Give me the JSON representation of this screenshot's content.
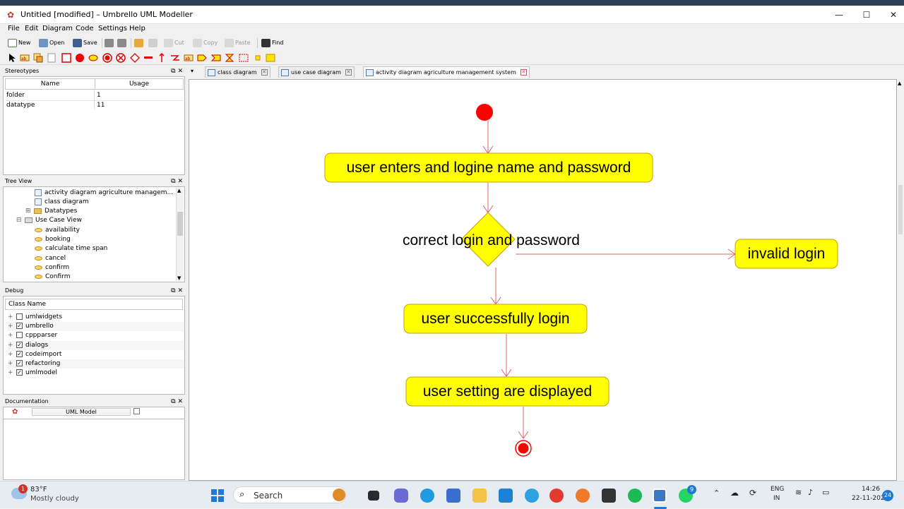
{
  "window": {
    "title": "Untitled [modified] – Umbrello UML Modeller",
    "controls": [
      "—",
      "☐",
      "✕"
    ]
  },
  "menu": [
    "File",
    "Edit",
    "Diagram",
    "Code",
    "Settings",
    "Help"
  ],
  "toolbar": {
    "new": "New",
    "open": "Open",
    "save": "Save",
    "cut": "Cut",
    "copy": "Copy",
    "paste": "Paste",
    "find": "Find"
  },
  "stereotypes": {
    "title": "Stereotypes",
    "columns": [
      "Name",
      "Usage"
    ],
    "rows": [
      {
        "name": "folder",
        "usage": "1"
      },
      {
        "name": "datatype",
        "usage": "11"
      }
    ]
  },
  "tree_view": {
    "title": "Tree View",
    "items": [
      "activity diagram agriculture managem...",
      "class diagram",
      "Datatypes",
      "Use Case View",
      "availability",
      "booking",
      "calculate time span",
      "cancel",
      "confirm",
      "Confirm"
    ]
  },
  "debug": {
    "title": "Debug",
    "column": "Class Name",
    "rows": [
      {
        "name": "umlwidgets",
        "checked": false
      },
      {
        "name": "umbrello",
        "checked": true
      },
      {
        "name": "cppparser",
        "checked": false
      },
      {
        "name": "dialogs",
        "checked": true
      },
      {
        "name": "codeimport",
        "checked": true
      },
      {
        "name": "refactoring",
        "checked": true
      },
      {
        "name": "umlmodel",
        "checked": true
      }
    ]
  },
  "documentation": {
    "title": "Documentation",
    "field": "UML Model"
  },
  "tabs": [
    {
      "label": "class diagram"
    },
    {
      "label": "use case diagram"
    },
    {
      "label": "activity diagram agriculture management system",
      "active": true
    }
  ],
  "diagram": {
    "activity_login": "user enters and logine name and password",
    "decision_label": "correct login and password",
    "activity_invalid": "invalid login",
    "activity_success": "user successfully login",
    "activity_settings": "user setting are displayed"
  },
  "taskbar": {
    "weather_temp": "83°F",
    "weather_desc": "Mostly cloudy",
    "search": "Search",
    "lang1": "ENG",
    "lang2": "IN",
    "time": "14:26",
    "date": "22-11-2023",
    "notif_count": "24",
    "weather_badge": "1",
    "whatsapp_badge": "9"
  },
  "colors": {
    "activity_fill": "#ffff00",
    "activity_border": "#c8a000",
    "initial_node": "#ff0000",
    "flow_line": "#e06070"
  }
}
